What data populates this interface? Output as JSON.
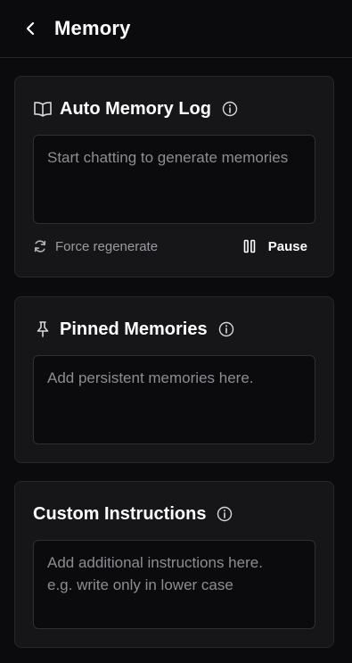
{
  "header": {
    "back_icon": "chevron-left-icon",
    "title": "Memory"
  },
  "auto_memory": {
    "icon": "book-open-icon",
    "title": "Auto Memory Log",
    "info_icon": "info-icon",
    "placeholder": "Start chatting to generate memories",
    "regenerate_icon": "refresh-icon",
    "regenerate_label": "Force regenerate",
    "pause_icon": "pause-icon",
    "pause_label": "Pause"
  },
  "pinned": {
    "icon": "pin-icon",
    "title": "Pinned Memories",
    "info_icon": "info-icon",
    "placeholder": "Add persistent memories here."
  },
  "custom": {
    "title": "Custom Instructions",
    "info_icon": "info-icon",
    "placeholder": "Add additional instructions here.\ne.g. write only in lower case"
  },
  "colors": {
    "background": "#0b0b0d",
    "card": "#161618",
    "border": "#26272b",
    "muted_text": "#8c8d92"
  }
}
